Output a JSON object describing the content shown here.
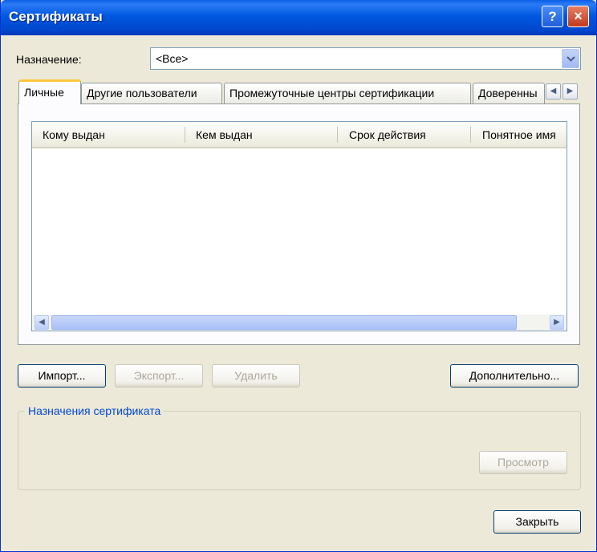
{
  "window": {
    "title": "Сертификаты"
  },
  "titlebar": {
    "help_label": "?",
    "close_label": "×"
  },
  "purpose": {
    "label": "Назначение:",
    "selected": "<Все>"
  },
  "tabs": [
    {
      "label": "Личные"
    },
    {
      "label": "Другие пользователи"
    },
    {
      "label": "Промежуточные центры сертификации"
    },
    {
      "label": "Доверенны"
    }
  ],
  "tab_scroll": {
    "left": "◀",
    "right": "▶"
  },
  "list": {
    "columns": [
      "Кому выдан",
      "Кем выдан",
      "Срок действия",
      "Понятное имя"
    ],
    "rows": []
  },
  "scrollbar": {
    "left": "◀",
    "right": "▶"
  },
  "buttons": {
    "import": "Импорт...",
    "export": "Экспорт...",
    "delete": "Удалить",
    "advanced": "Дополнительно...",
    "view": "Просмотр",
    "close": "Закрыть"
  },
  "purposes_group": {
    "label": "Назначения сертификата"
  },
  "colors": {
    "title_blue": "#0054e3",
    "dialog_bg": "#ece9d8",
    "group_label": "#0046d5"
  }
}
